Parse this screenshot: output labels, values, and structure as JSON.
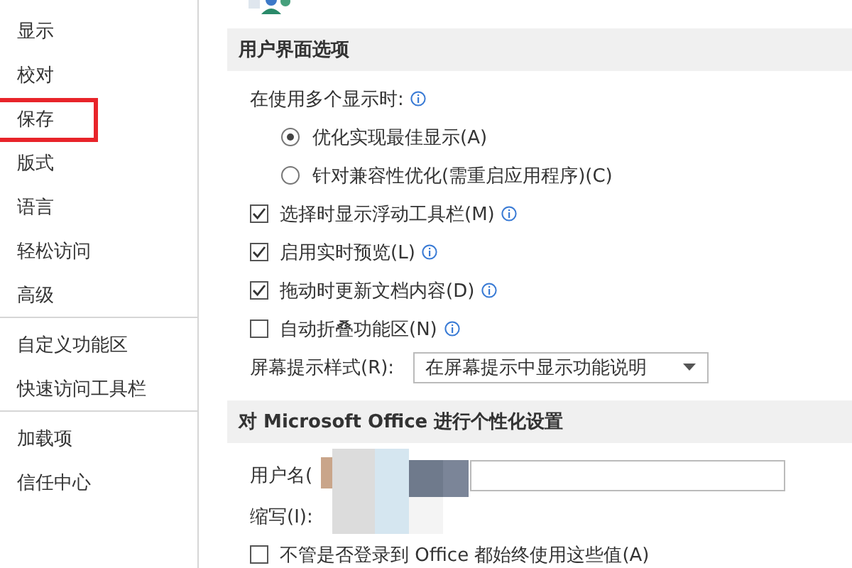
{
  "sidebar": {
    "groups": [
      {
        "items": [
          {
            "label": "显示",
            "selected": false
          },
          {
            "label": "校对",
            "selected": false
          },
          {
            "label": "保存",
            "selected": false,
            "highlighted": true
          },
          {
            "label": "版式",
            "selected": false
          },
          {
            "label": "语言",
            "selected": false
          },
          {
            "label": "轻松访问",
            "selected": false
          },
          {
            "label": "高级",
            "selected": false
          }
        ]
      },
      {
        "items": [
          {
            "label": "自定义功能区",
            "selected": false
          },
          {
            "label": "快速访问工具栏",
            "selected": false
          }
        ]
      },
      {
        "items": [
          {
            "label": "加载项",
            "selected": false
          },
          {
            "label": "信任中心",
            "selected": false
          }
        ]
      }
    ]
  },
  "sections": [
    {
      "title": "用户界面选项",
      "rows": [
        {
          "kind": "label",
          "label": "在使用多个显示时:",
          "info": true
        },
        {
          "kind": "radio",
          "label": "优化实现最佳显示(A)",
          "selected": true
        },
        {
          "kind": "radio",
          "label": "针对兼容性优化(需重启应用程序)(C)",
          "selected": false
        },
        {
          "kind": "checkbox",
          "label": "选择时显示浮动工具栏(M)",
          "checked": true,
          "info": true
        },
        {
          "kind": "checkbox",
          "label": "启用实时预览(L)",
          "checked": true,
          "info": true
        },
        {
          "kind": "checkbox",
          "label": "拖动时更新文档内容(D)",
          "checked": true,
          "info": true
        },
        {
          "kind": "checkbox",
          "label": "自动折叠功能区(N)",
          "checked": false,
          "info": true
        },
        {
          "kind": "select",
          "label": "屏幕提示样式(R):",
          "value": "在屏幕提示中显示功能说明"
        }
      ]
    },
    {
      "title": "对 Microsoft Office 进行个性化设置",
      "rows": [
        {
          "kind": "field",
          "label": "用户名(",
          "redacted": true
        },
        {
          "kind": "label",
          "label": "缩写(I):"
        },
        {
          "kind": "checkbox",
          "label": "不管是否登录到 Office 都始终使用这些值(A)",
          "checked": false
        }
      ]
    }
  ]
}
